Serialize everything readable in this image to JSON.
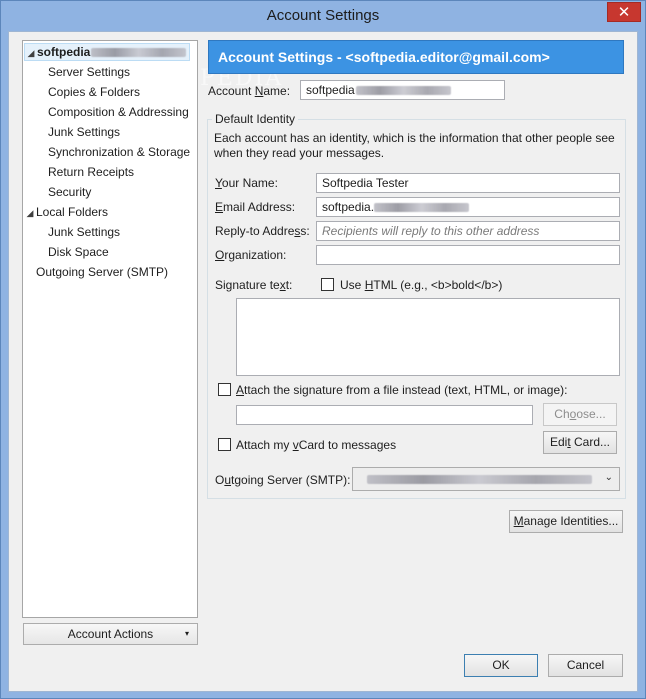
{
  "window": {
    "title": "Account Settings",
    "close_glyph": "✕"
  },
  "tree": {
    "account_name": "softpedia",
    "items": [
      {
        "label": "Server Settings"
      },
      {
        "label": "Copies & Folders"
      },
      {
        "label": "Composition & Addressing"
      },
      {
        "label": "Junk Settings"
      },
      {
        "label": "Synchronization & Storage"
      },
      {
        "label": "Return Receipts"
      },
      {
        "label": "Security"
      }
    ],
    "local_folders": "Local Folders",
    "local_items": [
      {
        "label": "Junk Settings"
      },
      {
        "label": "Disk Space"
      }
    ],
    "outgoing": "Outgoing Server (SMTP)",
    "account_actions": "Account Actions",
    "account_actions_arrow": "▾"
  },
  "header": {
    "title": "Account Settings - <softpedia.editor@gmail.com>"
  },
  "form": {
    "account_name_label_pre": "Account ",
    "account_name_label_u": "N",
    "account_name_label_post": "ame:",
    "account_name_value": "softpedia",
    "default_identity": "Default Identity",
    "identity_desc": "Each account has an identity, which is the information that other people see when they read your messages.",
    "your_name_label_u": "Y",
    "your_name_label_post": "our Name:",
    "your_name_value": "Softpedia Tester",
    "email_label_u": "E",
    "email_label_post": "mail Address:",
    "email_value": "softpedia.",
    "reply_label_pre": "Reply-to Addre",
    "reply_label_u": "s",
    "reply_label_post": "s:",
    "reply_placeholder": "Recipients will reply to this other address",
    "org_label_u": "O",
    "org_label_post": "rganization:",
    "org_value": "",
    "signature_label_pre": "Signature te",
    "signature_label_u": "x",
    "signature_label_post": "t:",
    "use_html_pre": "Use ",
    "use_html_u": "H",
    "use_html_post": "TML (e.g., <b>bold</b>)",
    "attach_sig_u": "A",
    "attach_sig_post": "ttach the signature from a file instead (text, HTML, or image):",
    "choose_pre": "Ch",
    "choose_u": "o",
    "choose_post": "ose...",
    "attach_vcard_pre": "Attach my ",
    "attach_vcard_u": "v",
    "attach_vcard_post": "Card to messages",
    "edit_card_pre": "Edi",
    "edit_card_u": "t",
    "edit_card_post": " Card...",
    "outgoing_label_pre": "O",
    "outgoing_label_u": "u",
    "outgoing_label_post": "tgoing Server (SMTP):",
    "outgoing_chevron": "⌄",
    "manage_pre": "",
    "manage_u": "M",
    "manage_post": "anage Identities..."
  },
  "footer": {
    "ok": "OK",
    "cancel": "Cancel"
  },
  "watermark": "SOFTPEDIA"
}
